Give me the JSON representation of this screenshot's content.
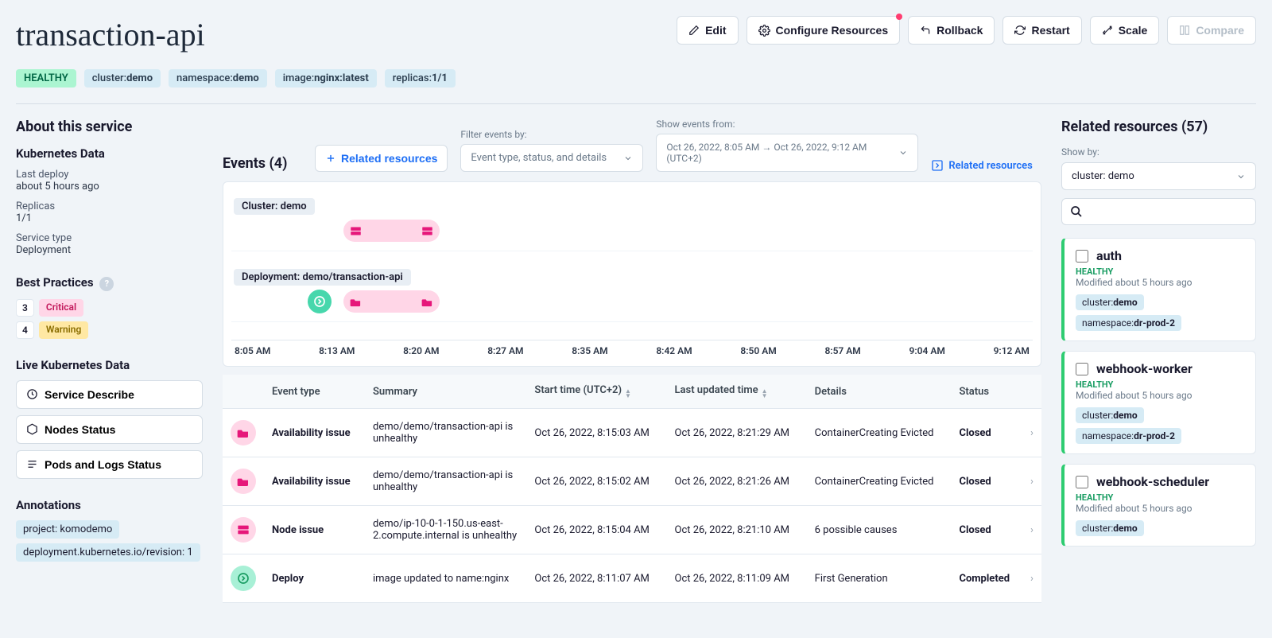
{
  "header": {
    "title": "transaction-api",
    "actions": {
      "edit": "Edit",
      "configure": "Configure Resources",
      "rollback": "Rollback",
      "restart": "Restart",
      "scale": "Scale",
      "compare": "Compare"
    }
  },
  "tags": {
    "healthy": "HEALTHY",
    "cluster_label": "cluster:",
    "cluster_val": "demo",
    "namespace_label": "namespace:",
    "namespace_val": "demo",
    "image_label": "image:",
    "image_val": "nginx:latest",
    "replicas_label": "replicas:",
    "replicas_val": "1/1"
  },
  "about": {
    "title": "About this service",
    "k8s_header": "Kubernetes Data",
    "last_deploy_label": "Last deploy",
    "last_deploy_val": "about 5 hours ago",
    "replicas_label": "Replicas",
    "replicas_val": "1/1",
    "service_type_label": "Service type",
    "service_type_val": "Deployment",
    "bp_header": "Best Practices",
    "bp_critical_count": "3",
    "bp_critical_label": "Critical",
    "bp_warning_count": "4",
    "bp_warning_label": "Warning",
    "live_header": "Live Kubernetes Data",
    "service_describe": "Service Describe",
    "nodes_status": "Nodes Status",
    "pods_logs": "Pods and Logs Status",
    "annotations_header": "Annotations",
    "ann1": "project: komodemo",
    "ann2": "deployment.kubernetes.io/revision: 1"
  },
  "events": {
    "title": "Events (4)",
    "related_btn": "Related resources",
    "filter_label": "Filter events by:",
    "filter_placeholder": "Event type, status, and details",
    "show_label": "Show events from:",
    "show_value": "Oct 26, 2022, 8:05 AM → Oct 26, 2022, 9:12 AM (UTC+2)",
    "related_link": "Related resources",
    "tl_cluster": "Cluster: demo",
    "tl_deployment": "Deployment: demo/transaction-api",
    "axis": [
      "8:05 AM",
      "8:13 AM",
      "8:20 AM",
      "8:27 AM",
      "8:35 AM",
      "8:42 AM",
      "8:50 AM",
      "8:57 AM",
      "9:04 AM",
      "9:12 AM"
    ],
    "columns": {
      "type": "Event type",
      "summary": "Summary",
      "start": "Start time (UTC+2)",
      "updated": "Last updated time",
      "details": "Details",
      "status": "Status"
    },
    "rows": [
      {
        "icon": "avail",
        "type": "Availability issue",
        "summary": "demo/demo/transaction-api is unhealthy",
        "start": "Oct 26, 2022, 8:15:03 AM",
        "updated": "Oct 26, 2022, 8:21:29 AM",
        "details": "ContainerCreating Evicted",
        "status": "Closed"
      },
      {
        "icon": "avail",
        "type": "Availability issue",
        "summary": "demo/demo/transaction-api is unhealthy",
        "start": "Oct 26, 2022, 8:15:02 AM",
        "updated": "Oct 26, 2022, 8:21:26 AM",
        "details": "ContainerCreating Evicted",
        "status": "Closed"
      },
      {
        "icon": "node",
        "type": "Node issue",
        "summary": "demo/ip-10-0-1-150.us-east-2.compute.internal is unhealthy",
        "start": "Oct 26, 2022, 8:15:04 AM",
        "updated": "Oct 26, 2022, 8:21:10 AM",
        "details": "6 possible causes",
        "status": "Closed"
      },
      {
        "icon": "deploy",
        "type": "Deploy",
        "summary": "image updated to name:nginx",
        "start": "Oct 26, 2022, 8:11:07 AM",
        "updated": "Oct 26, 2022, 8:11:09 AM",
        "details": "First Generation",
        "status": "Completed"
      }
    ]
  },
  "related": {
    "title": "Related resources (57)",
    "showby_label": "Show by:",
    "showby_val": "cluster: demo",
    "cards": [
      {
        "name": "auth",
        "health": "HEALTHY",
        "modified": "Modified about 5 hours ago",
        "t1_label": "cluster:",
        "t1_val": "demo",
        "t2_label": "namespace:",
        "t2_val": "dr-prod-2"
      },
      {
        "name": "webhook-worker",
        "health": "HEALTHY",
        "modified": "Modified about 5 hours ago",
        "t1_label": "cluster:",
        "t1_val": "demo",
        "t2_label": "namespace:",
        "t2_val": "dr-prod-2"
      },
      {
        "name": "webhook-scheduler",
        "health": "HEALTHY",
        "modified": "Modified about 5 hours ago",
        "t1_label": "cluster:",
        "t1_val": "demo",
        "t2_label": "",
        "t2_val": ""
      }
    ]
  }
}
